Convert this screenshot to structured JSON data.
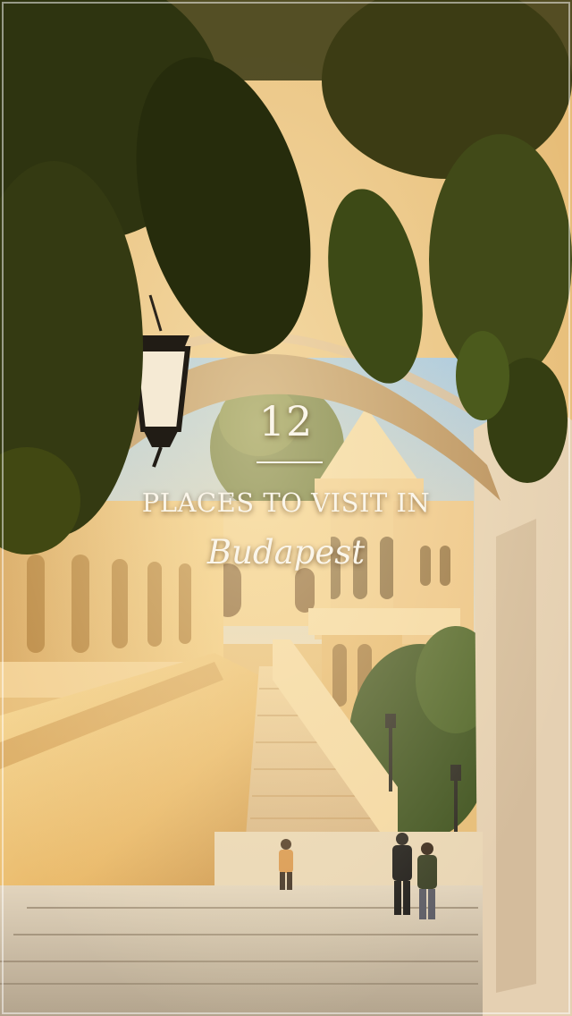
{
  "overlay": {
    "number": "12",
    "line1": "PLACES TO VISIT IN",
    "line2": "Budapest"
  },
  "colors": {
    "text": "#fbf6ea",
    "stone_light": "#f3d08a",
    "stone_shadow": "#a87a3c",
    "sky": "#a9cbe6",
    "foliage": "#2f3a12"
  }
}
